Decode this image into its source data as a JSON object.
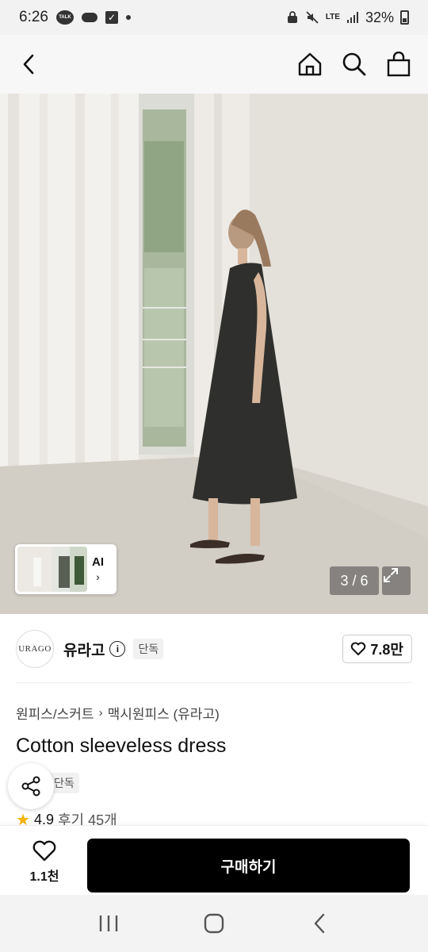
{
  "status_bar": {
    "time": "6:26",
    "talk_badge": "TALK",
    "network": "LTE",
    "battery": "32%"
  },
  "nav": {
    "back_icon": "chevron-left-icon",
    "home_icon": "home-icon",
    "search_icon": "search-icon",
    "bag_icon": "shopping-bag-icon"
  },
  "gallery": {
    "ai_label": "AI",
    "ai_arrow": "›",
    "counter": "3 / 6"
  },
  "brand": {
    "logo_text": "URAGO",
    "name": "유라고",
    "tag": "단독",
    "likes": "7.8만"
  },
  "breadcrumb": {
    "level1": "원피스/스커트",
    "separator": "›",
    "level2": "맥시원피스 (유라고)"
  },
  "product": {
    "title": "Cotton sleeveless dress",
    "tag": "단독",
    "rating": "4.9",
    "reviews": "후기 45개"
  },
  "action_bar": {
    "wish_count": "1.1천",
    "buy_label": "구매하기"
  },
  "colors": {
    "buy_button": "#000000",
    "star": "#f5b400",
    "tag_bg": "#f1f1f1"
  }
}
